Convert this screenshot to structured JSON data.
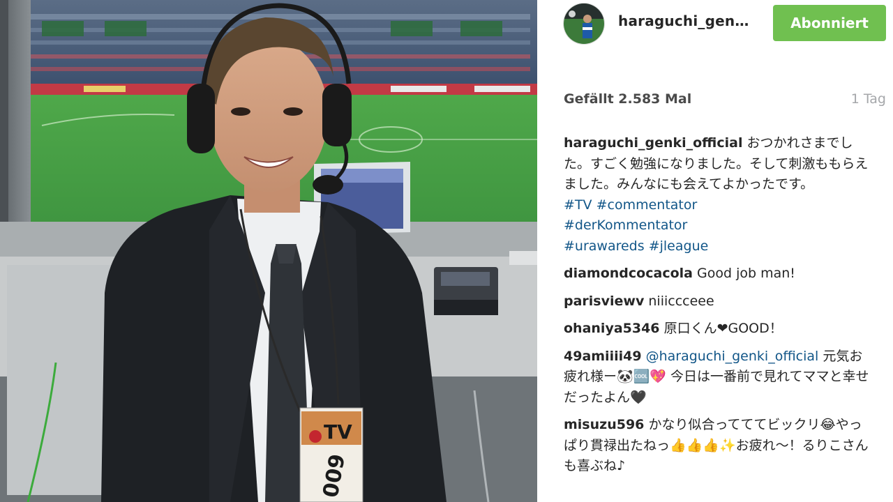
{
  "post": {
    "username": "haraguchi_gen…",
    "follow_label": "Abonniert",
    "likes": "Gefällt 2.583 Mal",
    "time": "1 Tag",
    "caption": {
      "user": "haraguchi_genki_official",
      "text": "おつかれさまでした。すごく勉強になりました。そして刺激ももらえました。みんなにも会えてよかったです。",
      "hashtags": [
        "#TV",
        "#commentator",
        "#derKommentator",
        "#urawareds",
        "#jleague"
      ]
    },
    "comments": [
      {
        "user": "diamondcocacola",
        "text": "Good job man!"
      },
      {
        "user": "parisviewv",
        "text": "niiiccceee"
      },
      {
        "user": "ohaniya5346",
        "text": "原口くん❤GOOD！"
      },
      {
        "user": "49amiiii49",
        "mention": "@haraguchi_genki_official",
        "text": "元気お疲れ様ー🐼🆒💖 今日は一番前で見れてママと幸せだったよん🖤"
      },
      {
        "user": "misuzu596",
        "text": "かなり似合ってててビックリ😂やっぱり貫禄出たねっ👍👍👍✨お疲れ～！るりこさんも喜ぶね♪"
      }
    ],
    "badge_number": "009",
    "badge_label": "TV"
  },
  "colors": {
    "follow_button": "#70c050",
    "hashtag": "#125688",
    "time": "#a5a7aa"
  }
}
